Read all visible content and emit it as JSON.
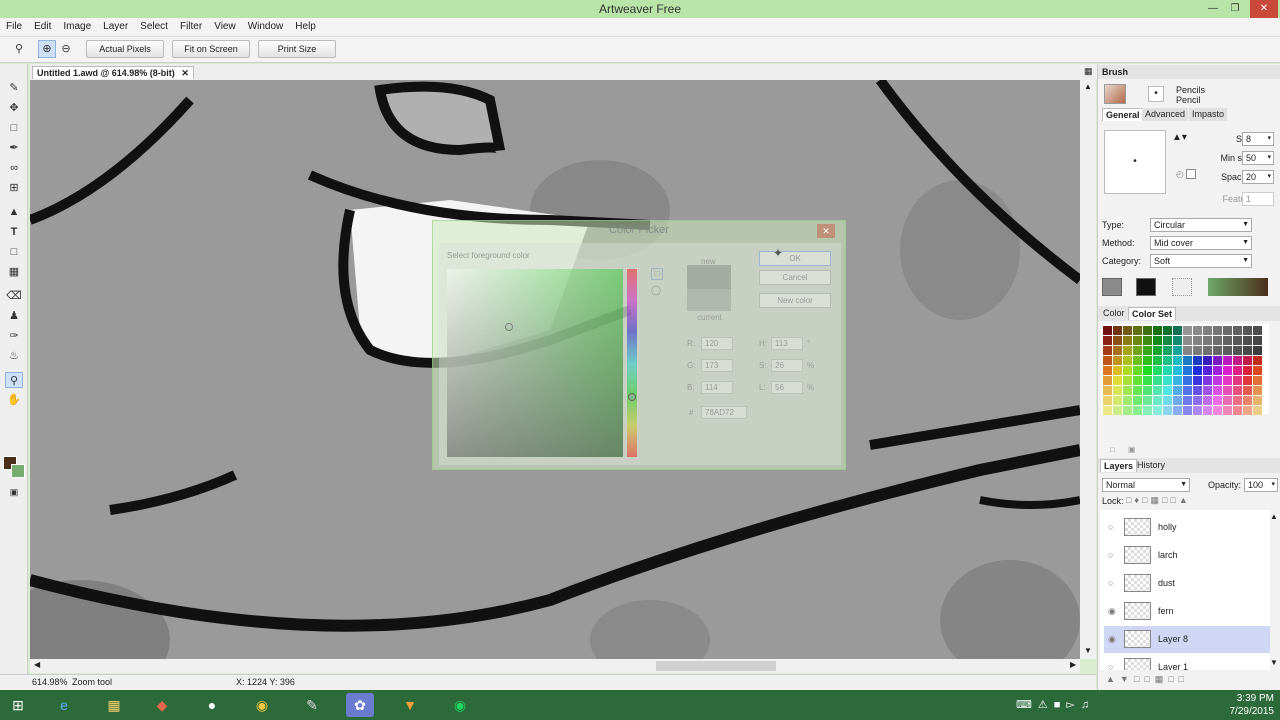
{
  "app": {
    "title": "Artweaver Free"
  },
  "menu": [
    "File",
    "Edit",
    "Image",
    "Layer",
    "Select",
    "Filter",
    "View",
    "Window",
    "Help"
  ],
  "toolbar": {
    "actual_pixels": "Actual Pixels",
    "fit_on_screen": "Fit on Screen",
    "print_size": "Print Size"
  },
  "document": {
    "tab_title": "Untitled 1.awd @ 614.98% (8-bit)"
  },
  "status": {
    "zoom": "614.98%",
    "tool": "Zoom tool",
    "coords": "X: 1224  Y: 396"
  },
  "brush_panel": {
    "title": "Brush",
    "category_name": "Pencils",
    "variant_name": "Pencil",
    "tabs": [
      "General",
      "Advanced",
      "Impasto"
    ],
    "size_label": "Size:",
    "size_value": "8",
    "min_size_label": "Min size:",
    "min_size_value": "50",
    "spacing_label": "Spacing:",
    "spacing_value": "20",
    "feature_label": "Feature:",
    "feature_value": "1",
    "type_label": "Type:",
    "type_value": "Circular",
    "method_label": "Method:",
    "method_value": "Mid cover",
    "category_label": "Category:",
    "category_value": "Soft"
  },
  "color_panel": {
    "tabs": [
      "Color",
      "Color Set"
    ]
  },
  "layers_panel": {
    "tabs": [
      "Layers",
      "History"
    ],
    "blend_mode": "Normal",
    "opacity_label": "Opacity:",
    "opacity_value": "100",
    "lock_label": "Lock:",
    "layers": [
      {
        "name": "holly",
        "visible": false,
        "active": false
      },
      {
        "name": "larch",
        "visible": false,
        "active": false
      },
      {
        "name": "dust",
        "visible": false,
        "active": false
      },
      {
        "name": "fern",
        "visible": true,
        "active": false
      },
      {
        "name": "Layer 8",
        "visible": true,
        "active": true
      },
      {
        "name": "Layer 1",
        "visible": false,
        "active": false
      }
    ]
  },
  "color_picker": {
    "title": "Color Picker",
    "subtitle": "Select foreground color",
    "ok_label": "OK",
    "cancel_label": "Cancel",
    "new_color_label": "New color",
    "new_label": "new",
    "current_label": "current",
    "r_label": "R:",
    "r_value": "120",
    "g_label": "G:",
    "g_value": "173",
    "b_label": "B:",
    "b_value": "114",
    "h_label": "H:",
    "h_value": "113",
    "h_unit": "°",
    "s_label": "S:",
    "s_value": "26",
    "s_unit": "%",
    "l_label": "L:",
    "l_value": "56",
    "l_unit": "%",
    "hash_label": "#",
    "hex_value": "78AD72"
  },
  "taskbar": {
    "time": "3:39 PM",
    "date": "7/29/2015"
  },
  "colors": {
    "foreground": "#4a2e1a",
    "background": "#78ad72",
    "accent": "#b8e4a8"
  }
}
